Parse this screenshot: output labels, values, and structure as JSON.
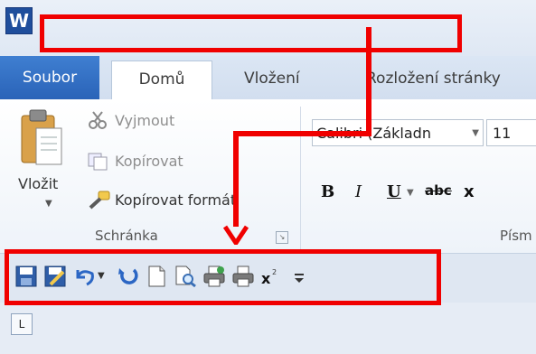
{
  "app": {
    "icon_letter": "W"
  },
  "tabs": {
    "file": "Soubor",
    "home": "Domů",
    "insert": "Vložení",
    "layout": "Rozložení stránky"
  },
  "clipboard": {
    "paste": "Vložit",
    "cut": "Vyjmout",
    "copy": "Kopírovat",
    "format_painter": "Kopírovat formát",
    "group_label": "Schránka"
  },
  "font": {
    "name": "Calibri (Základn",
    "size": "11",
    "group_label": "Písm",
    "bold": "B",
    "italic": "I",
    "underline": "U",
    "strikethrough": "abc",
    "subscript": "x"
  },
  "quick_access": [
    "save-icon",
    "save-as-icon",
    "undo-icon",
    "dropdown-icon",
    "redo-icon",
    "new-document-icon",
    "print-preview-icon",
    "quick-print-icon",
    "print-icon",
    "superscript-icon",
    "customize-icon"
  ],
  "ruler": {
    "tab_selector": "L"
  },
  "colors": {
    "annotation": "#f00000",
    "file_tab": "#2a63b8"
  }
}
